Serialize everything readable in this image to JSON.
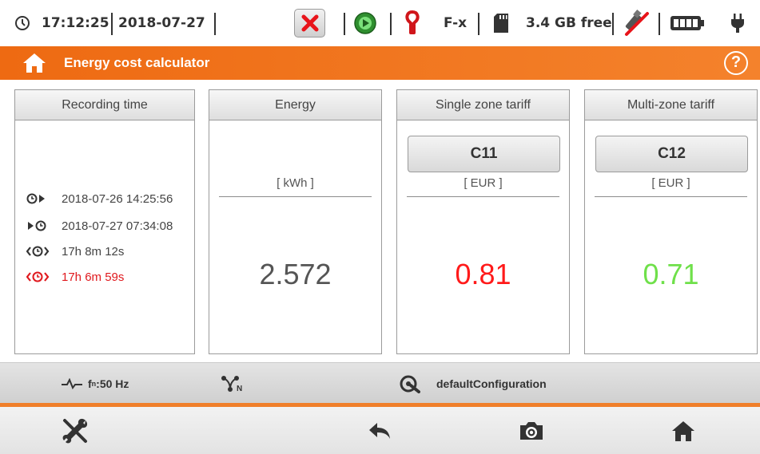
{
  "status_bar": {
    "time": "17:12:25",
    "date": "2018-07-27",
    "clamp_label": "F-x",
    "storage": "3.4 GB free"
  },
  "title_bar": {
    "title": "Energy cost calculator",
    "help_label": "?"
  },
  "panels": {
    "recording_time": {
      "header": "Recording time",
      "start": "2018-07-26 14:25:56",
      "end": "2018-07-27 07:34:08",
      "duration": "17h 8m 12s",
      "duration_active": "17h 6m 59s"
    },
    "energy": {
      "header": "Energy",
      "unit": "[ kWh ]",
      "value": "2.572"
    },
    "single_zone": {
      "header": "Single zone tariff",
      "tariff_button": "C11",
      "unit": "[ EUR ]",
      "value": "0.81"
    },
    "multi_zone": {
      "header": "Multi-zone tariff",
      "tariff_button": "C12",
      "unit": "[ EUR ]",
      "value": "0.71"
    }
  },
  "info_bar": {
    "frequency_prefix": "f",
    "frequency_sub": "n",
    "frequency_value": ":50 Hz",
    "network_sub": "N",
    "configuration": "defaultConfiguration"
  },
  "colors": {
    "accent": "#f07f2a",
    "cost_single": "#ff1a1a",
    "cost_multi": "#6fe04a",
    "recording_active": "#e0191e"
  },
  "icons": {
    "status_bar": [
      "clock-icon",
      "stop-icon",
      "play-icon",
      "clamp-icon",
      "sd-card-icon",
      "usb-icon",
      "battery-icon",
      "plug-icon"
    ],
    "title_bar": [
      "home-icon",
      "help-icon"
    ],
    "bottom_bar": [
      "tools-icon",
      "back-icon",
      "camera-icon",
      "home-icon"
    ]
  }
}
